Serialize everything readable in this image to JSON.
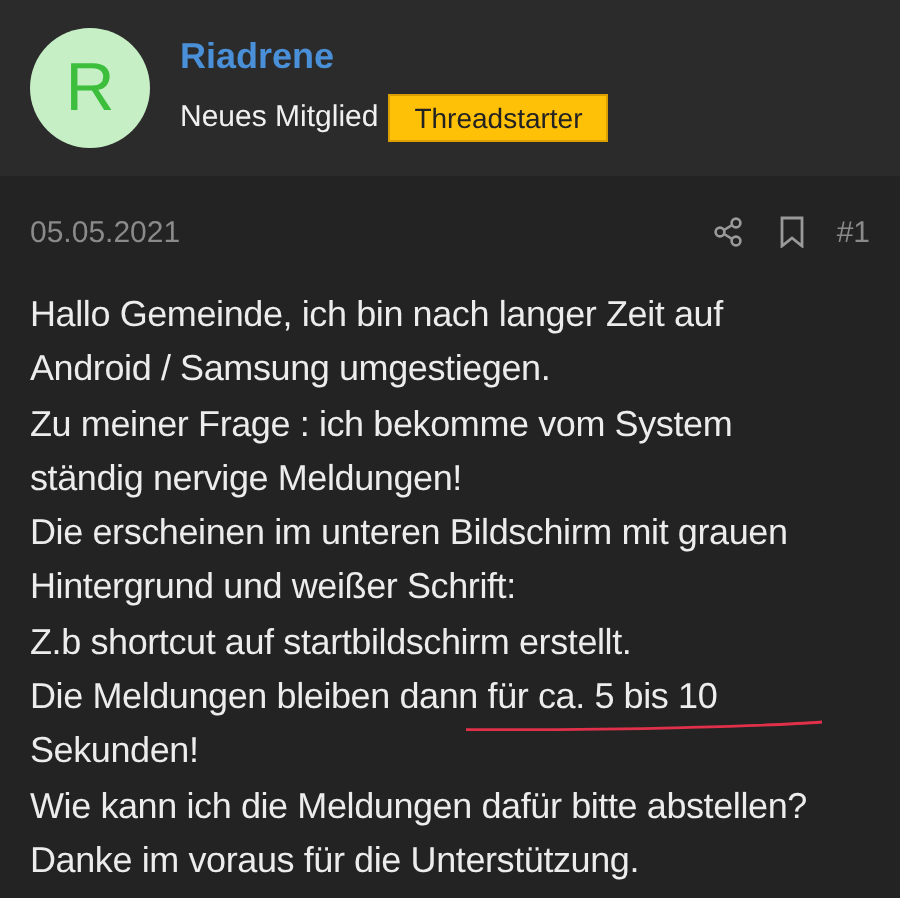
{
  "author": {
    "avatar_letter": "R",
    "name": "Riadrene",
    "role": "Neues Mitglied",
    "badge": "Threadstarter"
  },
  "post": {
    "date": "05.05.2021",
    "number": "#1",
    "paragraphs": [
      "Hallo Gemeinde, ich bin nach langer Zeit auf",
      "Android / Samsung umgestiegen.",
      "Zu meiner Frage : ich bekomme vom System",
      "ständig nervige Meldungen!",
      "Die erscheinen im unteren Bildschirm mit grauen",
      "Hintergrund und weißer Schrift:",
      "Z.b shortcut auf startbildschirm erstellt.",
      "Die Meldungen bleiben dann für ca. 5 bis 10",
      "Sekunden!",
      "Wie kann ich die Meldungen dafür bitte abstellen?",
      "Danke im voraus für die Unterstützung."
    ]
  }
}
